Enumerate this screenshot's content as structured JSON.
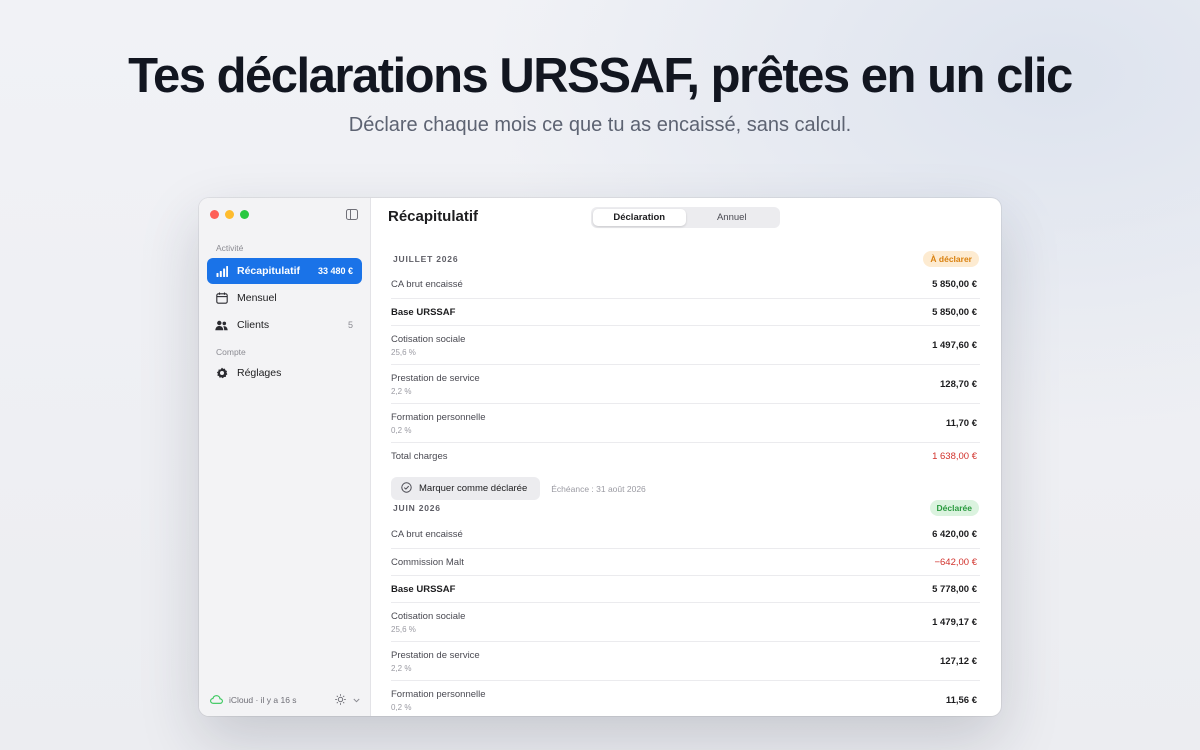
{
  "hero": {
    "headline": "Tes déclarations URSSAF, prêtes en un clic",
    "subline": "Déclare chaque mois ce que tu as encaissé, sans calcul."
  },
  "colors": {
    "accent": "#1a73e8",
    "negative": "#d2322c",
    "pending_pill": "#fdebd1",
    "declared_pill": "#dbf3df"
  },
  "sidebar": {
    "toggle_icon": "sidebar-toggle-icon",
    "sections": [
      {
        "label": "Activité",
        "items": [
          {
            "label": "Récapitulatif",
            "badge": "33 480 €",
            "icon": "chart-bars-icon",
            "active": true
          },
          {
            "label": "Mensuel",
            "badge": "",
            "icon": "calendar-icon",
            "active": false
          },
          {
            "label": "Clients",
            "badge": "5",
            "icon": "people-icon",
            "active": false
          }
        ]
      },
      {
        "label": "Compte",
        "items": [
          {
            "label": "Réglages",
            "badge": "",
            "icon": "gear-icon",
            "active": false
          }
        ]
      }
    ],
    "sync": {
      "status": "iCloud · il y a 16 s",
      "icon": "cloud-icon",
      "theme_icon": "sun-icon"
    }
  },
  "main": {
    "title": "Récapitulatif",
    "tabs": [
      {
        "label": "Déclaration",
        "selected": true
      },
      {
        "label": "Annuel",
        "selected": false
      }
    ],
    "periods": [
      {
        "title": "JUILLET 2026",
        "status": "À déclarer",
        "rows": [
          {
            "label": "CA brut encaissé",
            "sub": "",
            "value": "5 850,00 €"
          },
          {
            "label": "Base URSSAF",
            "sub": "",
            "value": "5 850,00 €"
          },
          {
            "label": "Cotisation sociale",
            "sub": "25,6 %",
            "value": "1 497,60 €"
          },
          {
            "label": "Prestation de service",
            "sub": "2,2 %",
            "value": "128,70 €"
          },
          {
            "label": "Formation personnelle",
            "sub": "0,2 %",
            "value": "11,70 €"
          },
          {
            "label": "Total charges",
            "sub": "",
            "value": "1 638,00 €"
          }
        ],
        "action": {
          "label": "Marquer comme déclarée",
          "deadline": "Échéance : 31 août 2026"
        }
      },
      {
        "title": "JUIN 2026",
        "status": "Déclarée",
        "rows": [
          {
            "label": "CA brut encaissé",
            "sub": "",
            "value": "6 420,00 €"
          },
          {
            "label": "Commission Malt",
            "sub": "",
            "value": "−642,00 €"
          },
          {
            "label": "Base URSSAF",
            "sub": "",
            "value": "5 778,00 €"
          },
          {
            "label": "Cotisation sociale",
            "sub": "25,6 %",
            "value": "1 479,17 €"
          },
          {
            "label": "Prestation de service",
            "sub": "2,2 %",
            "value": "127,12 €"
          },
          {
            "label": "Formation personnelle",
            "sub": "0,2 %",
            "value": "11,56 €"
          }
        ]
      }
    ]
  }
}
